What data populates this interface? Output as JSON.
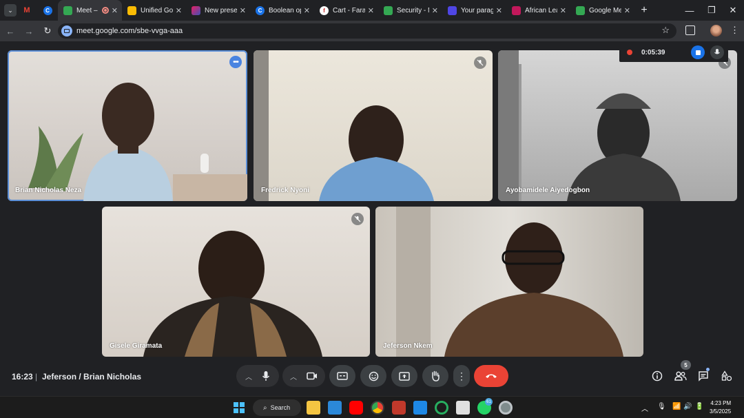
{
  "browser": {
    "tabs": [
      {
        "title": "",
        "favicon": "gmail-icon",
        "color": "#ea4335",
        "pinned": true
      },
      {
        "title": "",
        "favicon": "c-icon",
        "color": "#1a73e8",
        "pinned": true
      },
      {
        "title": "Meet –",
        "favicon": "meet-icon",
        "color": "#34a853",
        "active": true,
        "recording": true
      },
      {
        "title": "Unified Go",
        "favicon": "slides-icon",
        "color": "#fbbc04"
      },
      {
        "title": "New presen",
        "favicon": "pitch-icon",
        "color": "#a142f4"
      },
      {
        "title": "Boolean op",
        "favicon": "c-icon",
        "color": "#1a73e8"
      },
      {
        "title": "Cart - Faran",
        "favicon": "cart-icon",
        "color": "#ffffff"
      },
      {
        "title": "Security - N",
        "favicon": "security-icon",
        "color": "#34a853"
      },
      {
        "title": "Your parag",
        "favicon": "para-icon",
        "color": "#4f46e5"
      },
      {
        "title": "African Lea",
        "favicon": "africa-icon",
        "color": "#c2185b"
      },
      {
        "title": "Google Me",
        "favicon": "meet-icon",
        "color": "#34a853"
      }
    ],
    "url": "meet.google.com/sbe-vvga-aaa"
  },
  "recording": {
    "time": "0:05:39"
  },
  "participants": [
    {
      "name": "Brian Nicholas Neza",
      "speaking": true,
      "muted": false,
      "bg": "#d9d4ce"
    },
    {
      "name": "Fredrick Nyoni",
      "speaking": false,
      "muted": true,
      "bg": "#c9c6bf"
    },
    {
      "name": "Ayobamidele Aiyedogbon",
      "speaking": false,
      "muted": true,
      "bg": "#bdbdbd"
    },
    {
      "name": "Gisele Giramata",
      "speaking": false,
      "muted": true,
      "bg": "#cfc9c2"
    },
    {
      "name": "Jeferson Nkem",
      "speaking": false,
      "muted": false,
      "bg": "#b9b6b0"
    }
  ],
  "footer": {
    "clock": "16:23",
    "meeting": "Jeferson / Brian Nicholas",
    "people_count": "5"
  },
  "taskbar": {
    "search": "Search",
    "time": "4:23 PM",
    "date": "3/5/2025",
    "whatsapp_badge": "61"
  }
}
